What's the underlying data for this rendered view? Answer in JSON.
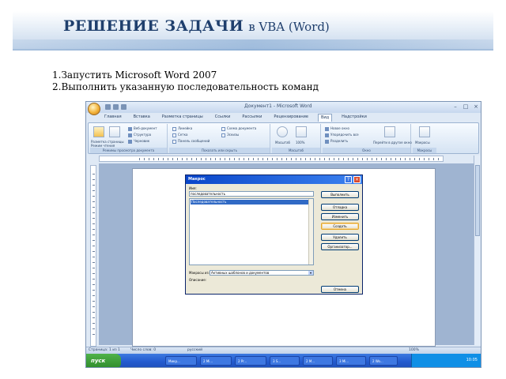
{
  "slide": {
    "title_main": "РЕШЕНИЕ ЗАДАЧИ",
    "title_sub": "в VBA (Word)",
    "steps": [
      "1.Запустить Microsoft Word 2007",
      "2.Выполнить указанную последовательность команд"
    ]
  },
  "word": {
    "window_title": "Документ1 - Microsoft Word",
    "window_buttons": [
      "–",
      "□",
      "×"
    ],
    "tabs": [
      "Главная",
      "Вставка",
      "Разметка страницы",
      "Ссылки",
      "Рассылки",
      "Рецензирование",
      "Вид",
      "Надстройки"
    ],
    "active_tab": "Вид",
    "ribbon_groups": [
      {
        "label": "Режимы просмотра документа",
        "items": [
          "Разметка страницы",
          "Режим чтения",
          "Веб-документ",
          "Структура",
          "Черновик"
        ]
      },
      {
        "label": "Показать или скрыть",
        "items": [
          "Линейка",
          "Сетка",
          "Панель сообщений",
          "Схема документа",
          "Эскизы"
        ]
      },
      {
        "label": "Масштаб",
        "items": [
          "Масштаб",
          "100%"
        ]
      },
      {
        "label": "Окно",
        "items": [
          "Новое окно",
          "Упорядочить все",
          "Разделить",
          "Перейти в другое окно"
        ]
      },
      {
        "label": "Макросы",
        "items": [
          "Макросы"
        ]
      }
    ],
    "status_left": "Страница: 1 из 1",
    "status_words": "Число слов: 0",
    "status_lang": "русский",
    "zoom": "100%",
    "taskbar": {
      "start": "пуск",
      "items": [
        "Микр...",
        "2 Mi...",
        "2 Pr...",
        "3 S...",
        "2 M...",
        "3 Mi...",
        "2 Wo..."
      ],
      "clock": "10:05"
    }
  },
  "macro_dialog": {
    "title": "Макрос",
    "name_label": "Имя:",
    "name_value": "последовательность",
    "list_items": [
      "Последовательность"
    ],
    "buttons": [
      "Выполнить",
      "Отладка",
      "Изменить",
      "Создать",
      "Удалить",
      "Организатор..."
    ],
    "default_button": "Создать",
    "macros_in_label": "Макросы из:",
    "macros_in_value": "Активных шаблонов и документов",
    "description_label": "Описание:",
    "cancel": "Отмена"
  }
}
